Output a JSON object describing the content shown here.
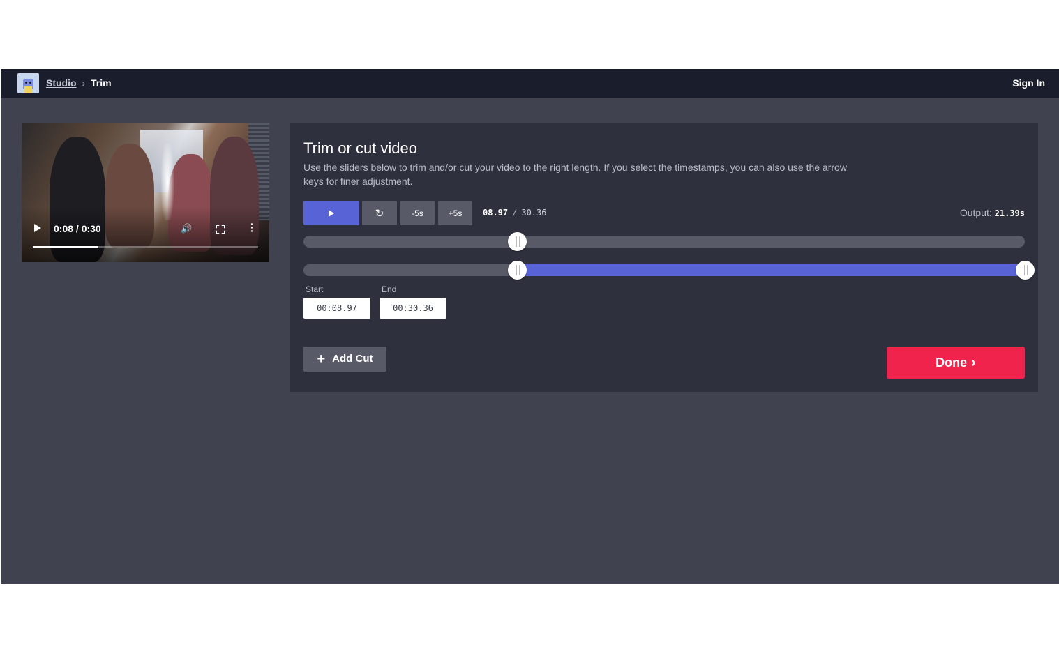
{
  "topbar": {
    "breadcrumb_root": "Studio",
    "breadcrumb_separator": "›",
    "breadcrumb_current": "Trim",
    "signin_label": "Sign In"
  },
  "video": {
    "time_display": "0:08 / 0:30",
    "progress_fraction": 0.29
  },
  "panel": {
    "title": "Trim or cut video",
    "description": "Use the sliders below to trim and/or cut your video to the right length. If you select the timestamps, you can also use the arrow keys for finer adjustment.",
    "buttons": {
      "reset_icon": "↻",
      "minus5_label": "-5s",
      "plus5_label": "+5s"
    },
    "current_time": "08.97",
    "total_time": "30.36",
    "output_label": "Output:",
    "output_value": "21.39s",
    "position_fraction": 0.2955,
    "range_start_fraction": 0.2955,
    "range_end_fraction": 1.0,
    "start_label": "Start",
    "start_value": "00:08.97",
    "end_label": "End",
    "end_value": "00:30.36",
    "add_cut_label": "Add Cut",
    "done_label": "Done"
  },
  "colors": {
    "accent": "#5863d6",
    "done": "#f0234d",
    "topbar": "#1a1d2b",
    "page": "#40434f",
    "panel": "#2e313d"
  }
}
